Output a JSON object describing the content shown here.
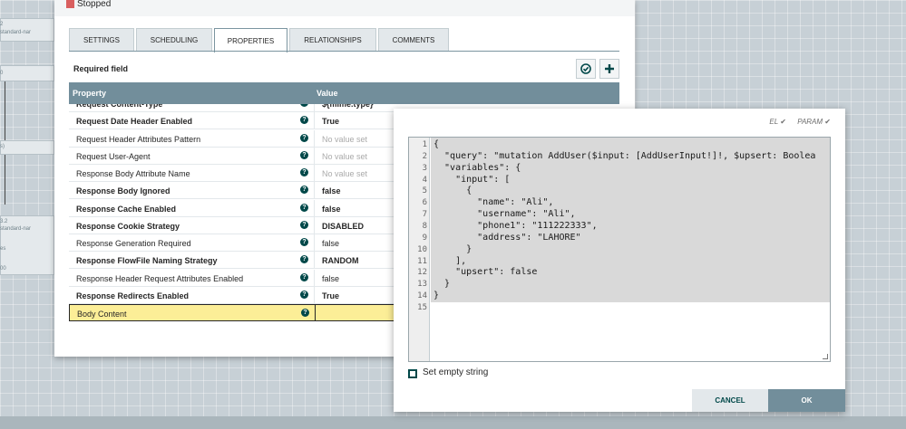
{
  "canvas": {
    "labels": [
      "2",
      "standard-nar",
      "0",
      "s)",
      "3.2",
      "standard-nar",
      "es",
      "00"
    ]
  },
  "dialog": {
    "status": "Stopped",
    "tabs": [
      {
        "label": "SETTINGS",
        "active": false
      },
      {
        "label": "SCHEDULING",
        "active": false
      },
      {
        "label": "PROPERTIES",
        "active": true
      },
      {
        "label": "RELATIONSHIPS",
        "active": false
      },
      {
        "label": "COMMENTS",
        "active": false
      }
    ],
    "required_label": "Required field",
    "grid": {
      "col_property": "Property",
      "col_value": "Value",
      "rows": [
        {
          "name": "Request Content-Type",
          "value": "${mime.type}",
          "bold": true,
          "empty": false,
          "partial": true
        },
        {
          "name": "Request Date Header Enabled",
          "value": "True",
          "bold": true,
          "empty": false
        },
        {
          "name": "Request Header Attributes Pattern",
          "value": "No value set",
          "bold": false,
          "empty": true
        },
        {
          "name": "Request User-Agent",
          "value": "No value set",
          "bold": false,
          "empty": true
        },
        {
          "name": "Response Body Attribute Name",
          "value": "No value set",
          "bold": false,
          "empty": true
        },
        {
          "name": "Response Body Ignored",
          "value": "false",
          "bold": true,
          "empty": false
        },
        {
          "name": "Response Cache Enabled",
          "value": "false",
          "bold": true,
          "empty": false
        },
        {
          "name": "Response Cookie Strategy",
          "value": "DISABLED",
          "bold": true,
          "empty": false
        },
        {
          "name": "Response Generation Required",
          "value": "false",
          "bold": false,
          "empty": false
        },
        {
          "name": "Response FlowFile Naming Strategy",
          "value": "RANDOM",
          "bold": true,
          "empty": false
        },
        {
          "name": "Response Header Request Attributes Enabled",
          "value": "false",
          "bold": false,
          "empty": false
        },
        {
          "name": "Response Redirects Enabled",
          "value": "True",
          "bold": true,
          "empty": false
        },
        {
          "name": "Body Content",
          "value": "",
          "bold": false,
          "empty": false,
          "selected": true
        }
      ]
    }
  },
  "editor": {
    "flag_el": "EL",
    "flag_param": "PARAM",
    "lines": [
      "{",
      "  \"query\": \"mutation AddUser($input: [AddUserInput!]!, $upsert: Boolea",
      "  \"variables\": {",
      "    \"input\": [",
      "      {",
      "        \"name\": \"Ali\",",
      "        \"username\": \"Ali\",",
      "        \"phone1\": \"111222333\",",
      "        \"address\": \"LAHORE\"",
      "      }",
      "    ],",
      "    \"upsert\": false",
      "  }",
      "}",
      ""
    ],
    "set_empty_label": "Set empty string",
    "cancel_label": "CANCEL",
    "ok_label": "OK"
  }
}
